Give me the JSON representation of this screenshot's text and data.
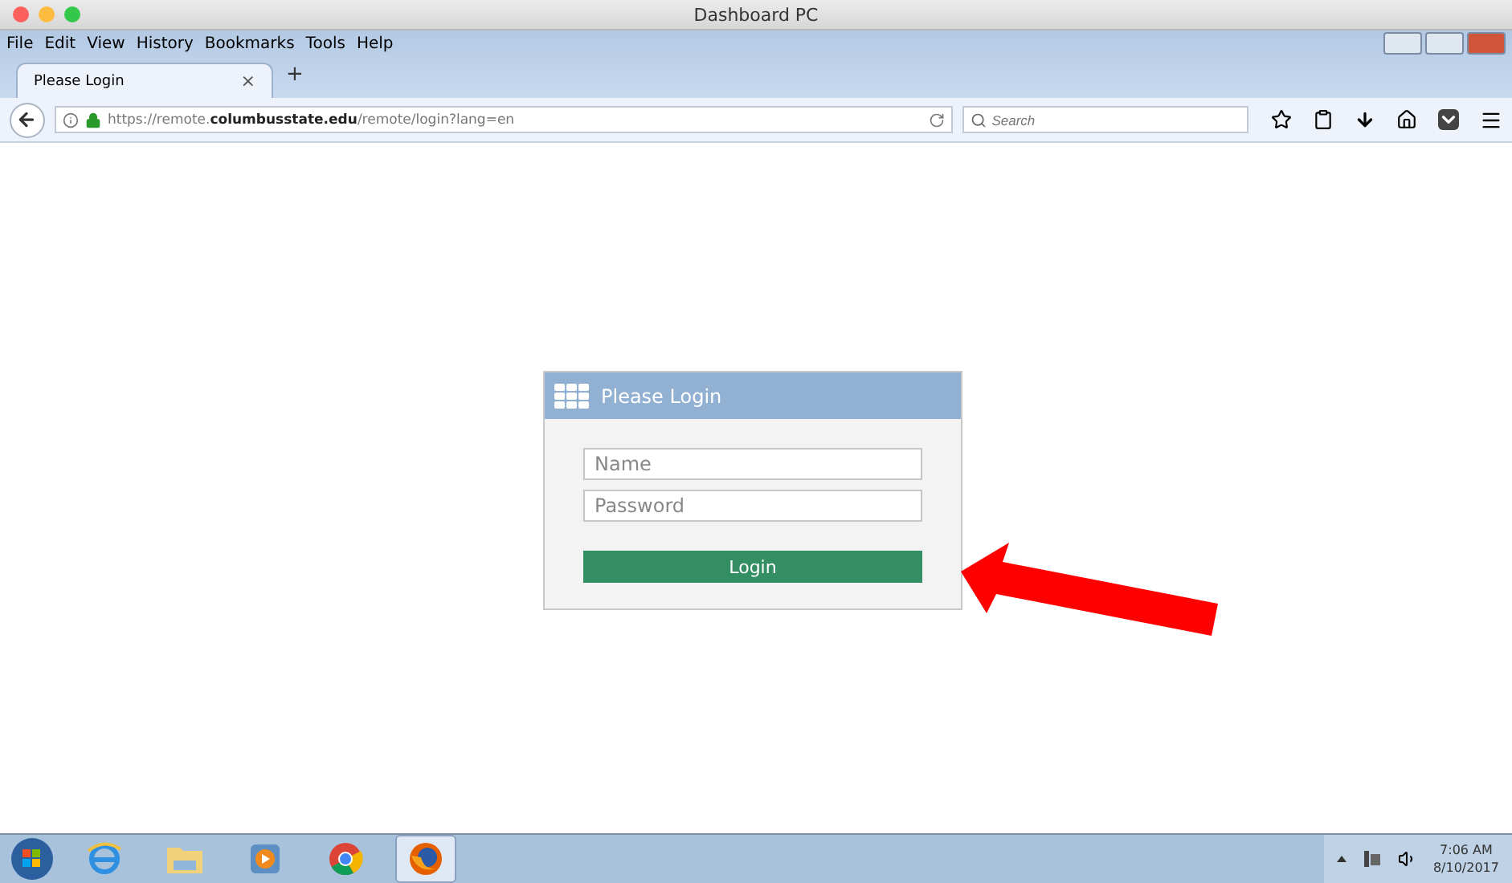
{
  "window": {
    "title": "Dashboard PC"
  },
  "menu": [
    "File",
    "Edit",
    "View",
    "History",
    "Bookmarks",
    "Tools",
    "Help"
  ],
  "tabs": [
    {
      "label": "Please Login",
      "selected": true,
      "close": "×"
    }
  ],
  "new_tab": "+",
  "address": {
    "url": "https://remote.**columbusstate.edu**/remote/login?lang=en"
  },
  "search": {
    "placeholder": "Search"
  },
  "login": {
    "title": "Please Login",
    "fields": [
      {
        "placeholder": "Name"
      },
      {
        "placeholder": "Password"
      }
    ],
    "button": "Login"
  },
  "taskbar": {
    "apps": [
      {
        "kind": "ie",
        "selected": false
      },
      {
        "kind": "folder",
        "selected": false
      },
      {
        "kind": "media",
        "selected": false
      },
      {
        "kind": "chrome",
        "selected": false
      },
      {
        "kind": "firefox",
        "selected": true
      }
    ],
    "time": "7:06 AM",
    "date": "8/10/2017"
  }
}
